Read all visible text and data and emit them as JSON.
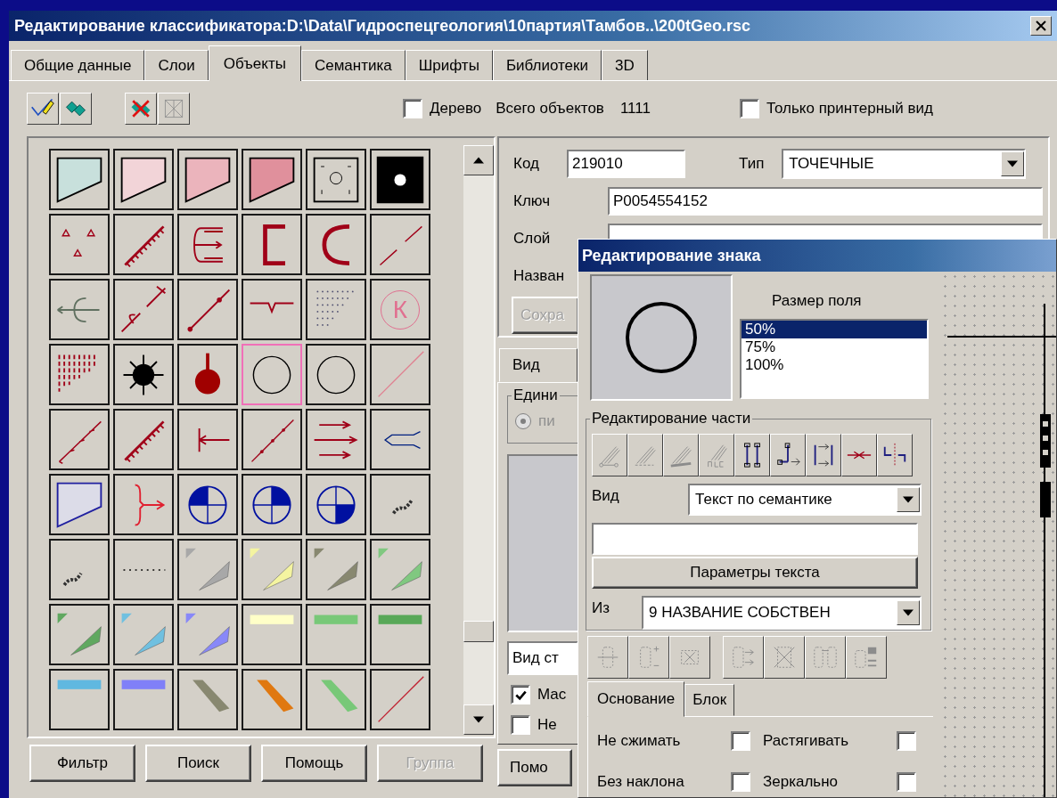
{
  "window": {
    "title": "Редактирование классификатора:D:\\Data\\Гидроспецгеология\\10партия\\Тамбов..\\200tGeo.rsc"
  },
  "tabs": [
    {
      "label": "Общие данные",
      "selected": false
    },
    {
      "label": "Слои",
      "selected": false
    },
    {
      "label": "Объекты",
      "selected": true
    },
    {
      "label": "Семантика",
      "selected": false
    },
    {
      "label": "Шрифты",
      "selected": false
    },
    {
      "label": "Библиотеки",
      "selected": false
    },
    {
      "label": "3D",
      "selected": false
    }
  ],
  "tree_checkbox": {
    "label": "Дерево",
    "checked": false
  },
  "object_count": {
    "label": "Всего объектов",
    "value": "1111"
  },
  "printer_checkbox": {
    "label": "Только принтерный вид",
    "checked": false
  },
  "symbols": [
    {
      "selected": false
    },
    {
      "selected": false
    },
    {
      "selected": false
    },
    {
      "selected": false
    },
    {
      "selected": false
    },
    {
      "selected": false
    },
    {
      "selected": false
    },
    {
      "selected": false
    },
    {
      "selected": false
    },
    {
      "selected": false
    },
    {
      "selected": false
    },
    {
      "selected": false
    },
    {
      "selected": false
    },
    {
      "selected": false
    },
    {
      "selected": false
    },
    {
      "selected": false
    },
    {
      "selected": false
    },
    {
      "selected": false,
      "glyph": "К"
    },
    {
      "selected": false
    },
    {
      "selected": false
    },
    {
      "selected": false
    },
    {
      "selected": true
    },
    {
      "selected": false
    },
    {
      "selected": false
    },
    {
      "selected": false
    },
    {
      "selected": false
    },
    {
      "selected": false
    },
    {
      "selected": false
    },
    {
      "selected": false
    },
    {
      "selected": false
    },
    {
      "selected": false
    },
    {
      "selected": false
    },
    {
      "selected": false
    },
    {
      "selected": false
    },
    {
      "selected": false
    },
    {
      "selected": false
    },
    {
      "selected": false
    },
    {
      "selected": false
    },
    {
      "selected": false
    },
    {
      "selected": false
    },
    {
      "selected": false
    },
    {
      "selected": false
    },
    {
      "selected": false
    },
    {
      "selected": false
    },
    {
      "selected": false
    },
    {
      "selected": false
    },
    {
      "selected": false
    },
    {
      "selected": false
    },
    {
      "selected": false
    },
    {
      "selected": false
    },
    {
      "selected": false
    },
    {
      "selected": false
    },
    {
      "selected": false
    },
    {
      "selected": false
    }
  ],
  "buttons": [
    {
      "label": "Фильтр",
      "disabled": false
    },
    {
      "label": "Поиск",
      "disabled": false
    },
    {
      "label": "Помощь",
      "disabled": false
    },
    {
      "label": "Группа",
      "disabled": true
    }
  ],
  "object_form": {
    "code_label": "Код",
    "code": "219010",
    "type_label": "Тип",
    "type": "ТОЧЕЧНЫЕ",
    "key_label": "Ключ",
    "key": "P0054554152",
    "layer_label": "Слой",
    "name_label": "Назван",
    "save_button": {
      "label": "Сохра",
      "disabled": true
    }
  },
  "view_panel": {
    "tab": "Вид",
    "group": "Едини",
    "radio": {
      "label": "пи",
      "checked": true
    },
    "view_field": "Вид ст",
    "checkboxes": [
      {
        "label": "Мас",
        "checked": true
      },
      {
        "label": "Не",
        "checked": false
      }
    ],
    "help_button": "Помо"
  },
  "sign_dialog": {
    "title": "Редактирование знака",
    "field_size_label": "Размер поля",
    "sizes": [
      {
        "label": "50%",
        "selected": true
      },
      {
        "label": "75%",
        "selected": false
      },
      {
        "label": "100%",
        "selected": false
      }
    ],
    "part_group": "Редактирование части",
    "view_label": "Вид",
    "view_value": "Текст по семантике",
    "params_button": "Параметры текста",
    "from_label": "Из",
    "from_value": "9 НАЗВАНИЕ СОБСТВЕН",
    "tabs": [
      {
        "label": "Основание",
        "selected": true
      },
      {
        "label": "Блок",
        "selected": false
      }
    ],
    "options": [
      {
        "label": "Не сжимать",
        "checked": false
      },
      {
        "label": "Растягивать",
        "checked": false
      },
      {
        "label": "Без наклона",
        "checked": false
      },
      {
        "label": "Зеркально",
        "checked": false
      }
    ]
  }
}
